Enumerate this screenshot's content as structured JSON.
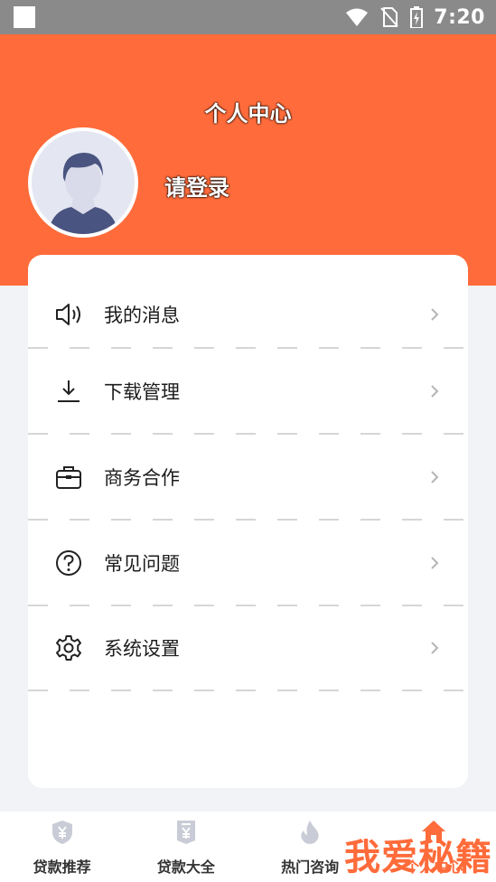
{
  "status_bar": {
    "time": "7:20",
    "icons": [
      "notification-square-icon",
      "wifi-icon",
      "no-sim-icon",
      "battery-charging-icon"
    ]
  },
  "header": {
    "title": "个人中心",
    "login_text": "请登录",
    "background_color": "#ff6b3a"
  },
  "menu": {
    "items": [
      {
        "label": "我的消息",
        "icon": "speaker-icon"
      },
      {
        "label": "下载管理",
        "icon": "download-icon"
      },
      {
        "label": "商务合作",
        "icon": "briefcase-icon"
      },
      {
        "label": "常见问题",
        "icon": "question-icon"
      },
      {
        "label": "系统设置",
        "icon": "gear-icon"
      }
    ]
  },
  "tab_bar": {
    "tabs": [
      {
        "label": "贷款推荐",
        "icon": "yen-shield-icon",
        "active": false
      },
      {
        "label": "贷款大全",
        "icon": "yen-document-icon",
        "active": false
      },
      {
        "label": "热门咨询",
        "icon": "flame-icon",
        "active": false
      },
      {
        "label": "个人中心",
        "icon": "home-icon",
        "active": true
      }
    ],
    "active_color": "#ff6b3a",
    "inactive_color": "#c9ccd6"
  },
  "watermark": "我爱秘籍"
}
